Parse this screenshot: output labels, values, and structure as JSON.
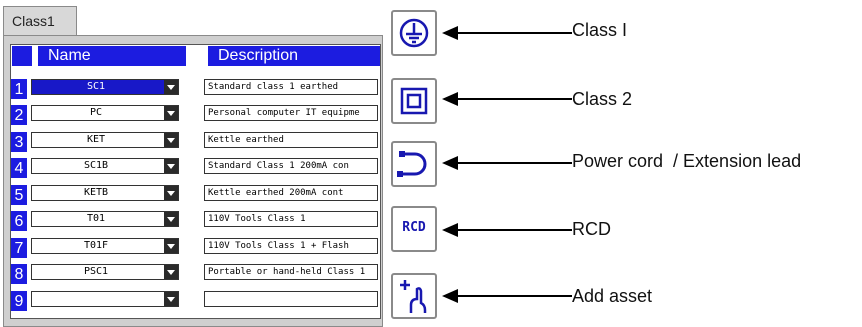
{
  "tab": {
    "label": "Class1"
  },
  "table": {
    "headers": {
      "name": "Name",
      "description": "Description"
    },
    "rows": [
      {
        "num": "1",
        "name": "SC1",
        "description": "Standard class 1 earthed"
      },
      {
        "num": "2",
        "name": "PC",
        "description": "Personal computer IT equipme"
      },
      {
        "num": "3",
        "name": "KET",
        "description": "Kettle earthed"
      },
      {
        "num": "4",
        "name": "SC1B",
        "description": "Standard Class 1 200mA con"
      },
      {
        "num": "5",
        "name": "KETB",
        "description": "Kettle earthed 200mA cont"
      },
      {
        "num": "6",
        "name": "T01",
        "description": "110V Tools Class 1"
      },
      {
        "num": "7",
        "name": "T01F",
        "description": "110V Tools Class 1 + Flash"
      },
      {
        "num": "8",
        "name": "PSC1",
        "description": "Portable or hand-held Class 1"
      },
      {
        "num": "9",
        "name": "",
        "description": ""
      }
    ]
  },
  "side_buttons": [
    {
      "icon": "earth-ground-icon",
      "callout": "Class I"
    },
    {
      "icon": "double-square-icon",
      "callout": "Class 2"
    },
    {
      "icon": "power-cord-icon",
      "callout": "Power cord  / Extension lead"
    },
    {
      "icon": "rcd-icon",
      "label": "RCD",
      "callout": "RCD"
    },
    {
      "icon": "add-asset-icon",
      "callout": "Add asset"
    }
  ],
  "colors": {
    "header_blue": "#1c1ce0",
    "selection_blue": "#1818c8",
    "icon_blue": "#1818b0"
  }
}
